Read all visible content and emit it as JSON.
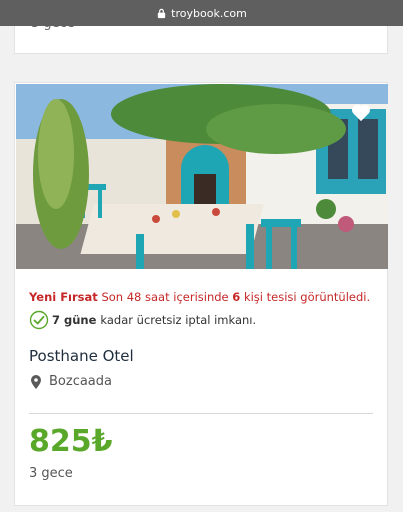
{
  "browser": {
    "url": "troybook.com"
  },
  "previous_card": {
    "nights": "3 gece"
  },
  "listing": {
    "promo": {
      "label": "Yeni Fırsat",
      "text_before": "Son 48 saat içerisinde",
      "count": "6",
      "text_after": "kişi tesisi görüntüledi."
    },
    "cancellation": {
      "days": "7 güne",
      "text": "kadar ücretsiz iptal imkanı."
    },
    "hotel_name": "Posthane Otel",
    "location": "Bozcaada",
    "price": "825₺",
    "nights": "3 gece"
  },
  "colors": {
    "promo_red": "#c62828",
    "price_green": "#5aa82a",
    "url_bar": "#5f5f5f"
  },
  "icons": [
    "lock-icon",
    "heart-icon",
    "check-circle-icon",
    "map-pin-icon"
  ]
}
